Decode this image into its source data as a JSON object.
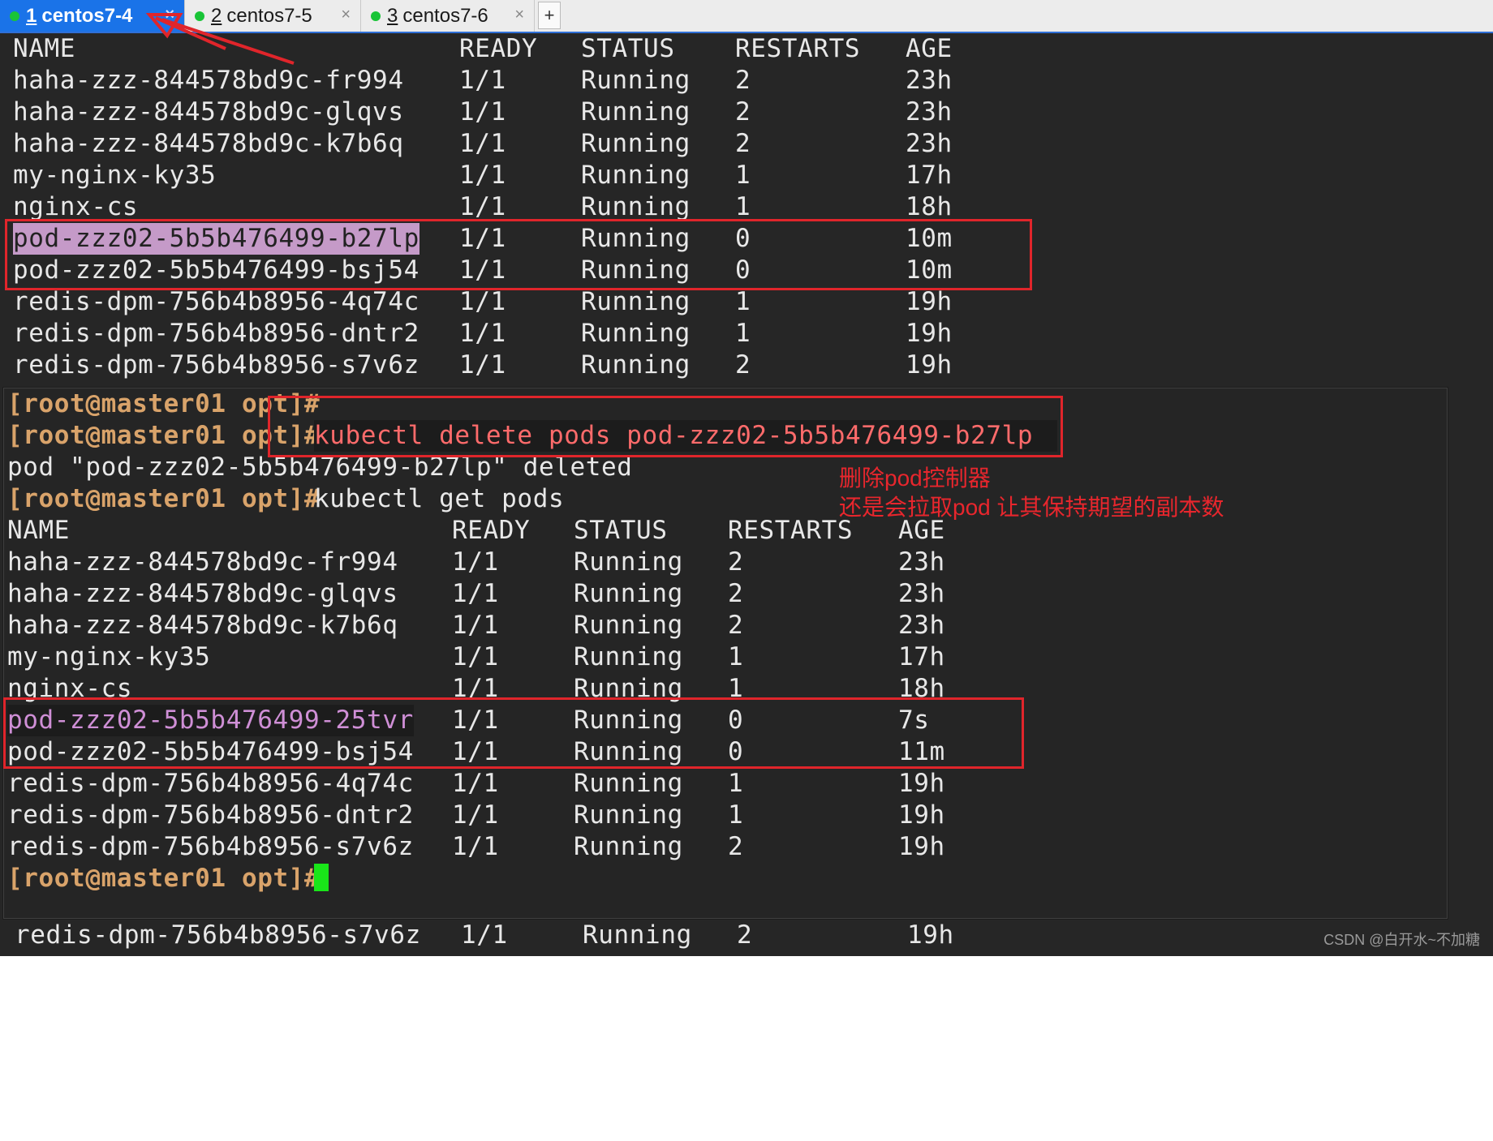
{
  "tabs": [
    {
      "num": "1",
      "title": "centos7-4",
      "close": "×"
    },
    {
      "num": "2",
      "title": "centos7-5",
      "close": "×"
    },
    {
      "num": "3",
      "title": "centos7-6",
      "close": "×"
    }
  ],
  "add_tab": "+",
  "terminal_bg": {
    "header": [
      "NAME",
      "READY",
      "STATUS",
      "RESTARTS",
      "AGE"
    ],
    "rows": [
      [
        "haha-zzz-844578bd9c-fr994",
        "1/1",
        "Running",
        "2",
        "23h"
      ],
      [
        "haha-zzz-844578bd9c-glqvs",
        "1/1",
        "Running",
        "2",
        "23h"
      ],
      [
        "haha-zzz-844578bd9c-k7b6q",
        "1/1",
        "Running",
        "2",
        "23h"
      ],
      [
        "my-nginx-ky35",
        "1/1",
        "Running",
        "1",
        "17h"
      ],
      [
        "nginx-cs",
        "1/1",
        "Running",
        "1",
        "18h"
      ],
      [
        "pod-zzz02-5b5b476499-b27lp",
        "1/1",
        "Running",
        "0",
        "10m"
      ],
      [
        "pod-zzz02-5b5b476499-bsj54",
        "1/1",
        "Running",
        "0",
        "10m"
      ],
      [
        "redis-dpm-756b4b8956-4q74c",
        "1/1",
        "Running",
        "1",
        "19h"
      ],
      [
        "redis-dpm-756b4b8956-dntr2",
        "1/1",
        "Running",
        "1",
        "19h"
      ],
      [
        "redis-dpm-756b4b8956-s7v6z",
        "1/1",
        "Running",
        "2",
        "19h"
      ]
    ],
    "bottom_row": [
      "redis-dpm-756b4b8956-s7v6z",
      "1/1",
      "Running",
      "2",
      "19h"
    ]
  },
  "terminal_fg": {
    "prompt": "[root@master01 opt]#",
    "cmd_delete": "kubectl delete pods pod-zzz02-5b5b476499-b27lp",
    "output_deleted": "pod \"pod-zzz02-5b5b476499-b27lp\" deleted",
    "cmd_get": "kubectl get pods",
    "header": [
      "NAME",
      "READY",
      "STATUS",
      "RESTARTS",
      "AGE"
    ],
    "rows": [
      [
        "haha-zzz-844578bd9c-fr994",
        "1/1",
        "Running",
        "2",
        "23h"
      ],
      [
        "haha-zzz-844578bd9c-glqvs",
        "1/1",
        "Running",
        "2",
        "23h"
      ],
      [
        "haha-zzz-844578bd9c-k7b6q",
        "1/1",
        "Running",
        "2",
        "23h"
      ],
      [
        "my-nginx-ky35",
        "1/1",
        "Running",
        "1",
        "17h"
      ],
      [
        "nginx-cs",
        "1/1",
        "Running",
        "1",
        "18h"
      ],
      [
        "pod-zzz02-5b5b476499-25tvr",
        "1/1",
        "Running",
        "0",
        "7s"
      ],
      [
        "pod-zzz02-5b5b476499-bsj54",
        "1/1",
        "Running",
        "0",
        "11m"
      ],
      [
        "redis-dpm-756b4b8956-4q74c",
        "1/1",
        "Running",
        "1",
        "19h"
      ],
      [
        "redis-dpm-756b4b8956-dntr2",
        "1/1",
        "Running",
        "1",
        "19h"
      ],
      [
        "redis-dpm-756b4b8956-s7v6z",
        "1/1",
        "Running",
        "2",
        "19h"
      ]
    ]
  },
  "annotation": {
    "line1": "删除pod控制器",
    "line2": "还是会拉取pod 让其保持期望的副本数"
  },
  "watermark": "CSDN @白开水~不加糖",
  "colors": {
    "annotation_red": "#e0252b",
    "prompt": "#d9a36a",
    "cursor": "#19e619",
    "tab_active": "#1a73e8"
  }
}
